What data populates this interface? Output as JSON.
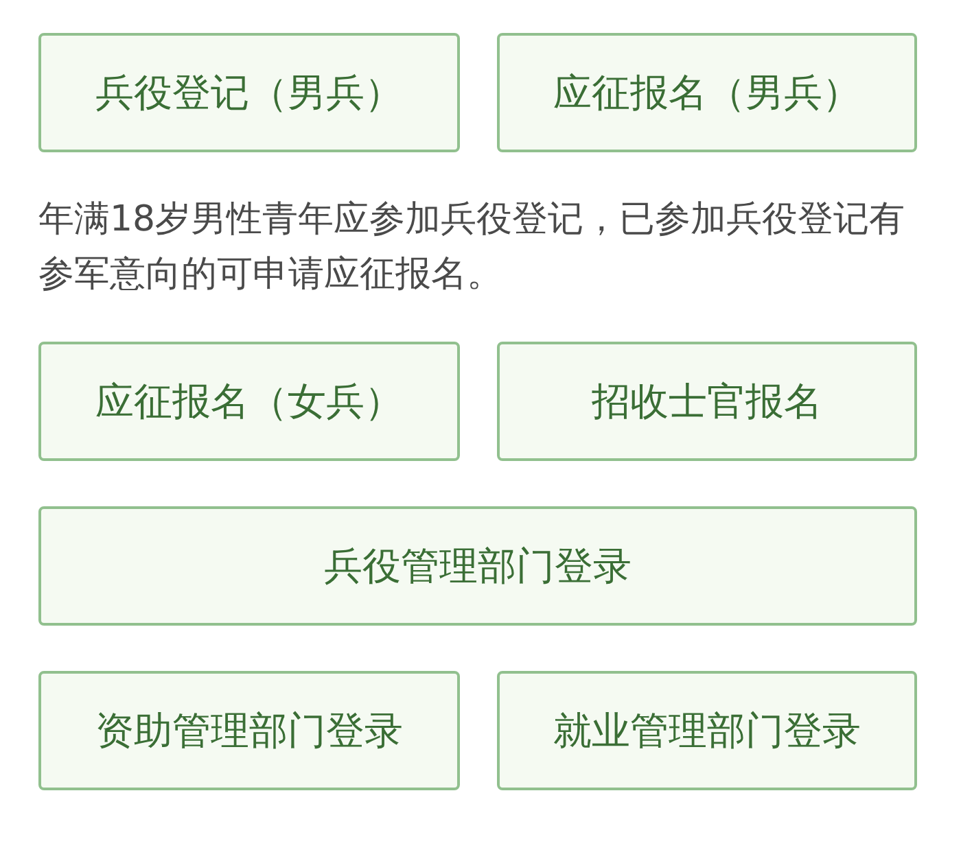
{
  "sections": [
    {
      "kind": "buttons",
      "buttons": [
        "兵役登记（男兵）",
        "应征报名（男兵）"
      ]
    },
    {
      "kind": "note",
      "text": "年满18岁男性青年应参加兵役登记，已参加兵役登记有参军意向的可申请应征报名。"
    },
    {
      "kind": "buttons",
      "buttons": [
        "应征报名（女兵）",
        "招收士官报名"
      ]
    },
    {
      "kind": "buttons",
      "buttons": [
        "兵役管理部门登录"
      ]
    },
    {
      "kind": "buttons",
      "buttons": [
        "资助管理部门登录",
        "就业管理部门登录"
      ]
    }
  ]
}
